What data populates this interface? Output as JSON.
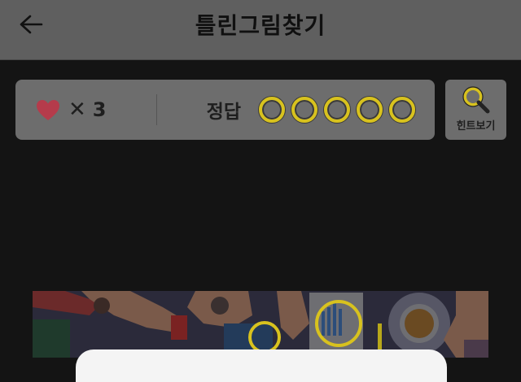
{
  "header": {
    "title": "틀린그림찾기",
    "back_icon": "arrow-left-icon"
  },
  "status": {
    "lives_icon": "heart-icon",
    "lives_symbol": "✕",
    "lives_count": "3",
    "answer_label": "정답",
    "answers_found": 0,
    "answers_total": 5
  },
  "hint": {
    "label": "힌트보기",
    "icon": "magnifier-icon"
  },
  "colors": {
    "dim_overlay": "#141414",
    "heart": "#b53b4b",
    "answer_ring": "#d8c21e",
    "hint_icon": "#d8c21e"
  }
}
